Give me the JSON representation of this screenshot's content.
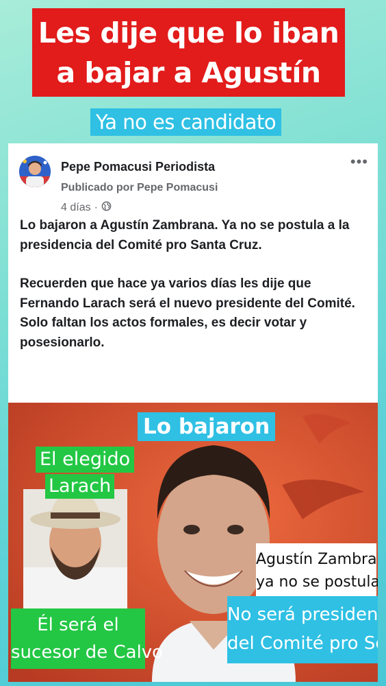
{
  "headline": {
    "line1": "Les dije que lo iban",
    "line2": "a bajar a Agustín"
  },
  "subhead": "Ya no es candidato",
  "post": {
    "page_name": "Pepe Pomacusi Periodista",
    "published_by": "Publicado por Pepe Pomacusi",
    "time": "4 días",
    "separator": "·",
    "more": "•••",
    "paragraph1": "Lo bajaron a Agustín Zambrana. Ya no se postula a la presidencia del Comité pro Santa Cruz.",
    "paragraph2": "Recuerden que hace ya varios días les dije que Fernando Larach será el nuevo presidente del Comité. Solo faltan los actos formales, es decir votar y posesionarlo."
  },
  "image_labels": {
    "lo_bajaron": "Lo bajaron",
    "el_elegido": "El elegido",
    "larach": "Larach",
    "sera_line1": "Él será el",
    "sera_line2": "sucesor de Calvo",
    "agustin_line1": "Agustín Zambrana",
    "agustin_line2": "ya no se postula",
    "no_sera_line1": "No será presidente",
    "no_sera_line2": "del Comité pro Scz"
  },
  "colors": {
    "red": "#e21b1b",
    "cyan": "#2fc0e4",
    "green": "#23c744"
  }
}
